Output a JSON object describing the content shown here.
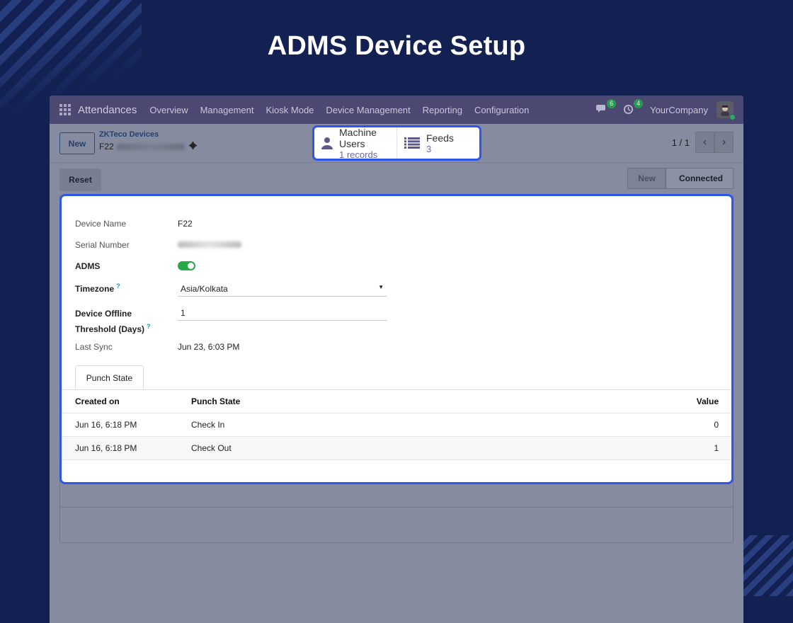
{
  "banner": {
    "title": "ADMS Device Setup"
  },
  "navbar": {
    "app_name": "Attendances",
    "menu": [
      "Overview",
      "Management",
      "Kiosk Mode",
      "Device Management",
      "Reporting",
      "Configuration"
    ],
    "messages_badge": "6",
    "activities_badge": "4",
    "company": "YourCompany"
  },
  "control_panel": {
    "new_button": "New",
    "breadcrumb_parent": "ZKTeco Devices",
    "breadcrumb_current": "F22",
    "pager": "1 / 1"
  },
  "smart_buttons": {
    "machine_users": {
      "title": "Machine Users",
      "value": "1 records"
    },
    "feeds": {
      "title": "Feeds",
      "value": "3"
    }
  },
  "status": {
    "reset_button": "Reset",
    "steps": [
      "New",
      "Connected"
    ],
    "active": "Connected"
  },
  "form": {
    "device_name_label": "Device Name",
    "device_name": "F22",
    "serial_label": "Serial Number",
    "adms_label": "ADMS",
    "adms_enabled": true,
    "timezone_label": "Timezone",
    "timezone": "Asia/Kolkata",
    "offline_label_1": "Device Offline",
    "offline_label_2": "Threshold (Days)",
    "offline_value": "1",
    "last_sync_label": "Last Sync",
    "last_sync": "Jun 23, 6:03 PM",
    "help_mark": "?"
  },
  "tab": {
    "label": "Punch State"
  },
  "table": {
    "columns": [
      "Created on",
      "Punch State",
      "Value"
    ],
    "rows": [
      {
        "created_on": "Jun 16, 6:18 PM",
        "punch_state": "Check In",
        "value": "0"
      },
      {
        "created_on": "Jun 16, 6:18 PM",
        "punch_state": "Check Out",
        "value": "1"
      }
    ]
  },
  "colors": {
    "accent": "#2f56e6",
    "navbar": "#4b4872",
    "toggle_on": "#28a745",
    "background": "#122052"
  }
}
